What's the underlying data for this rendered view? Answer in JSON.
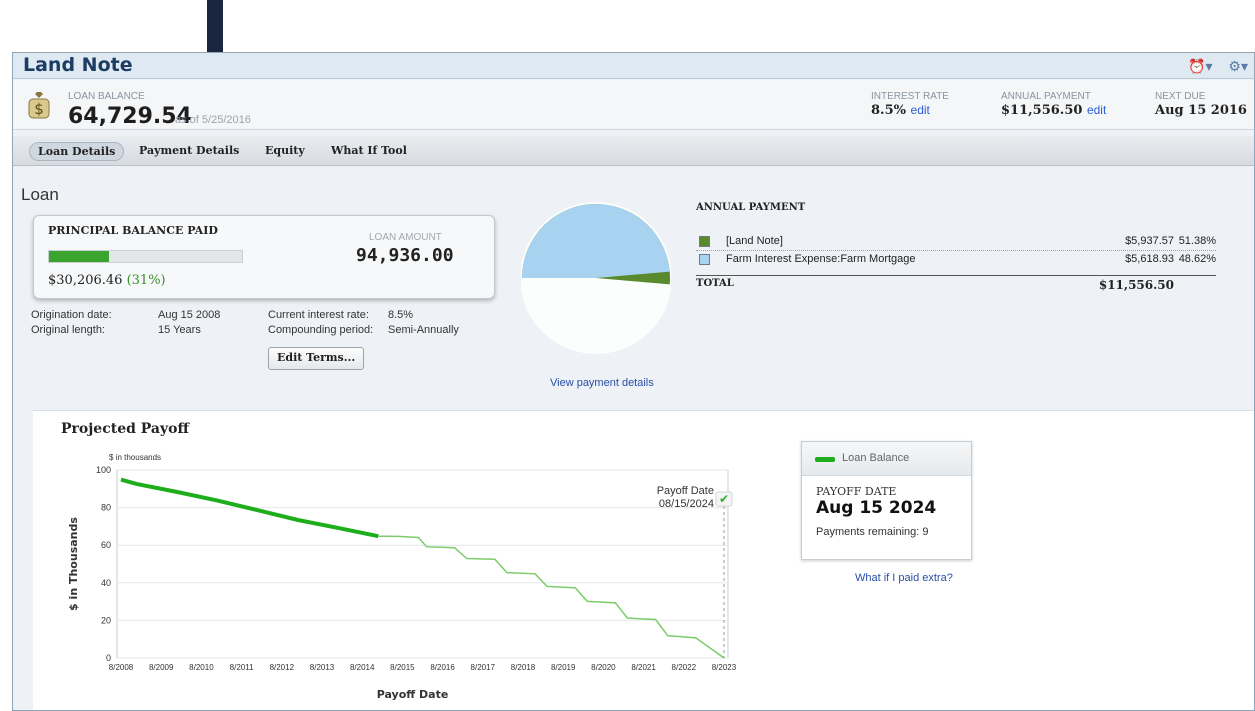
{
  "window": {
    "title": "Land Note"
  },
  "summary": {
    "loan_balance_label": "LOAN BALANCE",
    "loan_balance_value": "64,729.54",
    "as_of": "as of 5/25/2016",
    "interest_rate_label": "INTEREST RATE",
    "interest_rate_value": "8.5%",
    "annual_payment_label": "ANNUAL PAYMENT",
    "annual_payment_value": "$11,556.50",
    "next_due_label": "NEXT DUE",
    "next_due_value": "Aug 15 2016",
    "edit_label": "edit"
  },
  "tabs": [
    {
      "label": "Loan Details",
      "active": true
    },
    {
      "label": "Payment Details"
    },
    {
      "label": "Equity"
    },
    {
      "label": "What If Tool"
    }
  ],
  "loan": {
    "heading": "Loan",
    "principal_title": "PRINCIPAL BALANCE PAID",
    "principal_paid": "$30,206.46",
    "principal_pct": "(31%)",
    "principal_fraction": 0.31,
    "loan_amount_label": "LOAN AMOUNT",
    "loan_amount_value": "94,936.00",
    "terms": {
      "origination_label": "Origination date:",
      "origination_value": "Aug 15 2008",
      "length_label": "Original length:",
      "length_value": "15 Years",
      "rate_label": "Current interest rate:",
      "rate_value": "8.5%",
      "compounding_label": "Compounding period:",
      "compounding_value": "Semi-Annually"
    },
    "edit_terms_label": "Edit Terms..."
  },
  "annual_payment": {
    "title": "ANNUAL PAYMENT",
    "rows": [
      {
        "name": "[Land Note]",
        "amount": "$5,937.57",
        "pct": "51.38%",
        "color": "#5a8a2e"
      },
      {
        "name": "Farm Interest Expense:Farm Mortgage",
        "amount": "$5,618.93",
        "pct": "48.62%",
        "color": "#a7d3f0"
      }
    ],
    "total_label": "TOTAL",
    "total_amount": "$11,556.50",
    "view_details": "View payment details"
  },
  "payoff": {
    "title": "Projected Payoff",
    "legend": "Loan Balance",
    "payoff_date_label": "PAYOFF DATE",
    "payoff_date_value": "Aug 15 2024",
    "payments_remaining": "Payments remaining: 9",
    "what_if": "What if I paid extra?",
    "annotation_line1": "Payoff Date",
    "annotation_line2": "08/15/2024"
  },
  "chart_data": {
    "type": "line",
    "title": "Projected Payoff",
    "units_label": "$ in thousands",
    "xlabel": "Payoff Date",
    "ylabel": "$ in Thousands",
    "ylim": [
      0,
      100
    ],
    "yticks": [
      0,
      20,
      40,
      60,
      80,
      100
    ],
    "xticks": [
      "8/2008",
      "8/2009",
      "8/2010",
      "8/2011",
      "8/2012",
      "8/2013",
      "8/2014",
      "8/2015",
      "8/2016",
      "8/2017",
      "8/2018",
      "8/2019",
      "8/2020",
      "8/2021",
      "8/2022",
      "8/2023"
    ],
    "series": [
      {
        "name": "Loan Balance (actual)",
        "color": "#1fae1b",
        "points": [
          [
            2008.6,
            94.9
          ],
          [
            2009.0,
            92.5
          ],
          [
            2010.0,
            88.3
          ],
          [
            2011.0,
            83.7
          ],
          [
            2012.0,
            78.6
          ],
          [
            2013.0,
            73.4
          ],
          [
            2014.0,
            69.2
          ],
          [
            2015.0,
            64.8
          ]
        ]
      },
      {
        "name": "Loan Balance (projected)",
        "color": "#7ccc6b",
        "points": [
          [
            2015.0,
            64.8
          ],
          [
            2015.5,
            64.7
          ],
          [
            2016.0,
            64.1
          ],
          [
            2016.2,
            59.2
          ],
          [
            2016.9,
            58.6
          ],
          [
            2017.2,
            52.9
          ],
          [
            2017.9,
            52.5
          ],
          [
            2018.2,
            45.4
          ],
          [
            2018.9,
            44.8
          ],
          [
            2019.2,
            38.1
          ],
          [
            2019.9,
            37.3
          ],
          [
            2020.2,
            30.1
          ],
          [
            2020.9,
            29.3
          ],
          [
            2021.2,
            21.2
          ],
          [
            2021.9,
            20.5
          ],
          [
            2022.2,
            11.9
          ],
          [
            2022.9,
            10.7
          ],
          [
            2023.6,
            0.0
          ]
        ]
      }
    ],
    "payoff_x": 2023.6
  }
}
